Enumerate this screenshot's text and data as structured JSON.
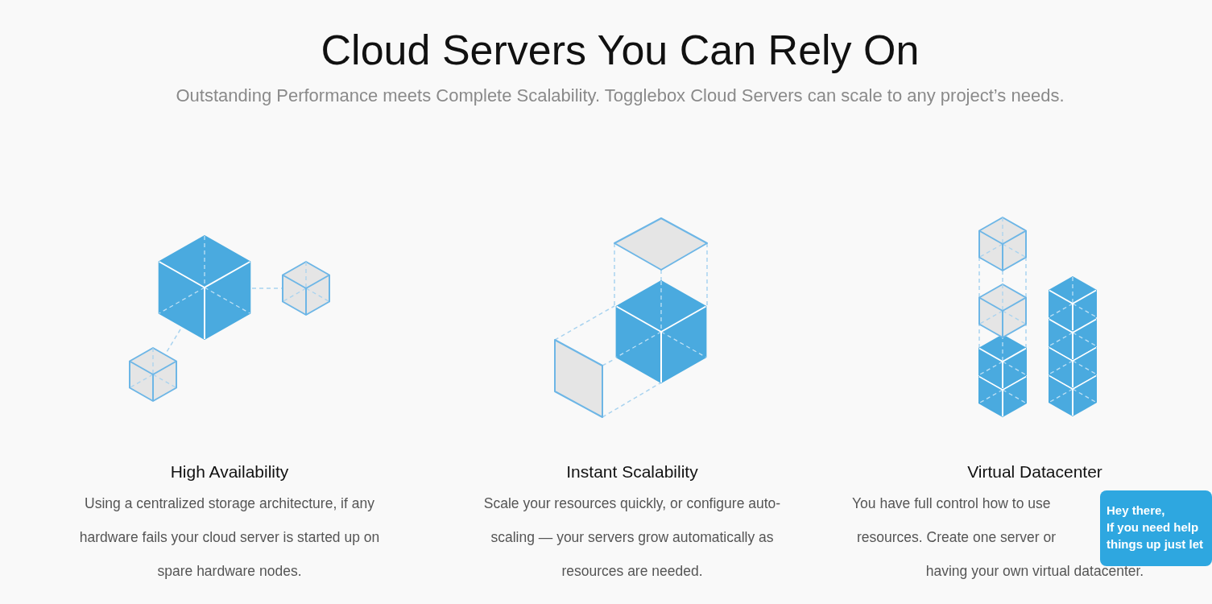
{
  "heading": "Cloud Servers You Can Rely On",
  "subtitle": "Outstanding Performance meets Complete Scalability. Togglebox Cloud Servers can scale to any project’s needs.",
  "features": [
    {
      "kind": "cluster",
      "title": "High Availability",
      "covered_by_chat": false,
      "description": [
        "Using a centralized storage architecture, if any",
        "hardware fails your cloud server is started up on",
        "spare hardware nodes."
      ]
    },
    {
      "kind": "scale",
      "title": "Instant Scalability",
      "covered_by_chat": false,
      "description": [
        "Scale your resources quickly, or configure auto-",
        "scaling — your servers grow automatically as",
        "resources are needed."
      ]
    },
    {
      "kind": "stack",
      "title": "Virtual Datacenter",
      "covered_by_chat": true,
      "description": [
        "You have full control how to use",
        "resources. Create one server or",
        "having your own virtual datacenter."
      ]
    }
  ],
  "chat": {
    "lines": [
      "Hey there,",
      "If you need help",
      "things up just let"
    ]
  }
}
